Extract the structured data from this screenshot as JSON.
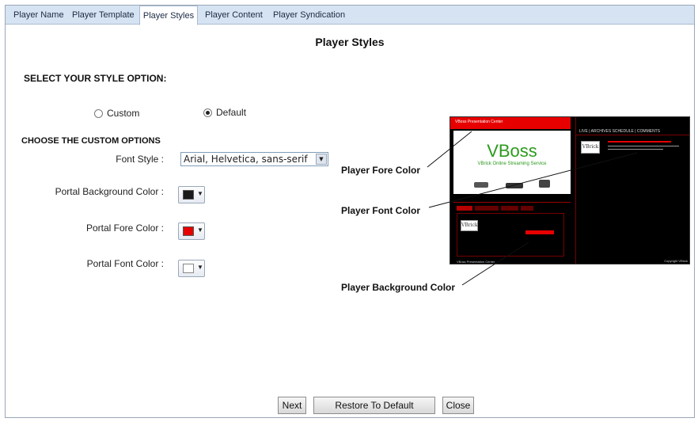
{
  "tabs": [
    {
      "label": "Player Name"
    },
    {
      "label": "Player Template"
    },
    {
      "label": "Player Styles",
      "active": true
    },
    {
      "label": "Player Content"
    },
    {
      "label": "Player Syndication"
    }
  ],
  "page": {
    "title": "Player Styles"
  },
  "style_option": {
    "heading": "SELECT YOUR STYLE OPTION:",
    "options": [
      {
        "label": "Custom",
        "checked": false
      },
      {
        "label": "Default",
        "checked": true
      }
    ]
  },
  "custom_options": {
    "heading": "CHOOSE THE CUSTOM OPTIONS",
    "font_style": {
      "label": "Font Style :",
      "value": "Arial, Helvetica, sans-serif"
    },
    "portal_background_color": {
      "label": "Portal Background Color :",
      "swatch": "#1a1a1a"
    },
    "portal_fore_color": {
      "label": "Portal Fore Color :",
      "swatch": "#e60000"
    },
    "portal_font_color": {
      "label": "Portal Font Color :",
      "swatch": "#ffffff"
    }
  },
  "annotations": {
    "player_fore_color": "Player Fore Color",
    "player_font_color": "Player Font Color",
    "player_background_color": "Player Background Color"
  },
  "preview": {
    "header_text": "VBoss Presentation Center",
    "brand": "VBoss",
    "tagline": "VBrick Online Streaming Service",
    "menu": "LIVE  |  ARCHIVES  SCHEDULE  |  COMMENTS",
    "logo_text": "VBrick",
    "footer_left": "VBoss Presentation Center",
    "footer_right": "Copyright VBrick",
    "accent_color": "#e60000",
    "brand_color": "#2c9a1e"
  },
  "buttons": {
    "next": "Next",
    "restore": "Restore To Default",
    "close": "Close"
  }
}
